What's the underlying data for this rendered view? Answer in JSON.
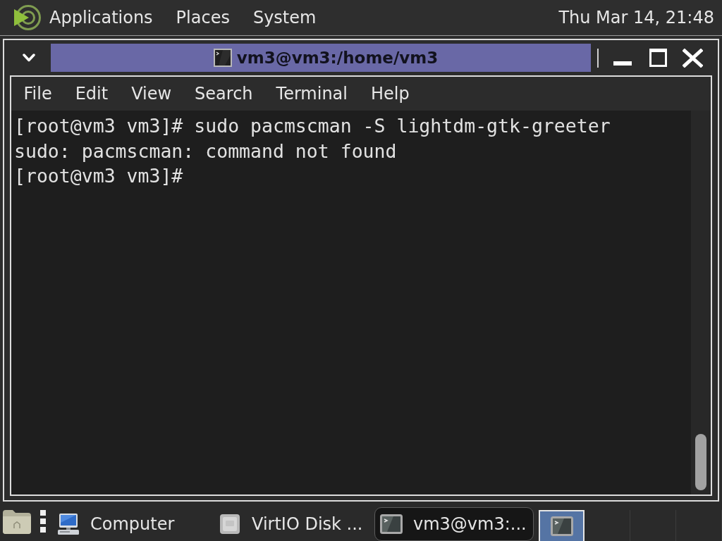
{
  "top_panel": {
    "menus": [
      "Applications",
      "Places",
      "System"
    ],
    "clock": "Thu Mar 14, 21:48"
  },
  "window": {
    "title": "vm3@vm3:/home/vm3",
    "menu_bar": [
      "File",
      "Edit",
      "View",
      "Search",
      "Terminal",
      "Help"
    ],
    "terminal_lines": [
      "[root@vm3 vm3]# sudo pacmscman -S lightdm-gtk-greeter",
      "sudo: pacmscman: command not found",
      "[root@vm3 vm3]#"
    ]
  },
  "taskbar": {
    "tasks": [
      {
        "kind": "computer",
        "label": "Computer",
        "selected": false
      },
      {
        "kind": "disk",
        "label": "VirtIO Disk ...",
        "selected": false
      },
      {
        "kind": "terminal",
        "label": "vm3@vm3:...",
        "selected": true
      }
    ],
    "workspaces": [
      {
        "selected": true,
        "windows": [
          {
            "kind": "terminal"
          }
        ]
      },
      {
        "selected": false
      },
      {
        "selected": false
      },
      {
        "selected": false
      }
    ]
  }
}
